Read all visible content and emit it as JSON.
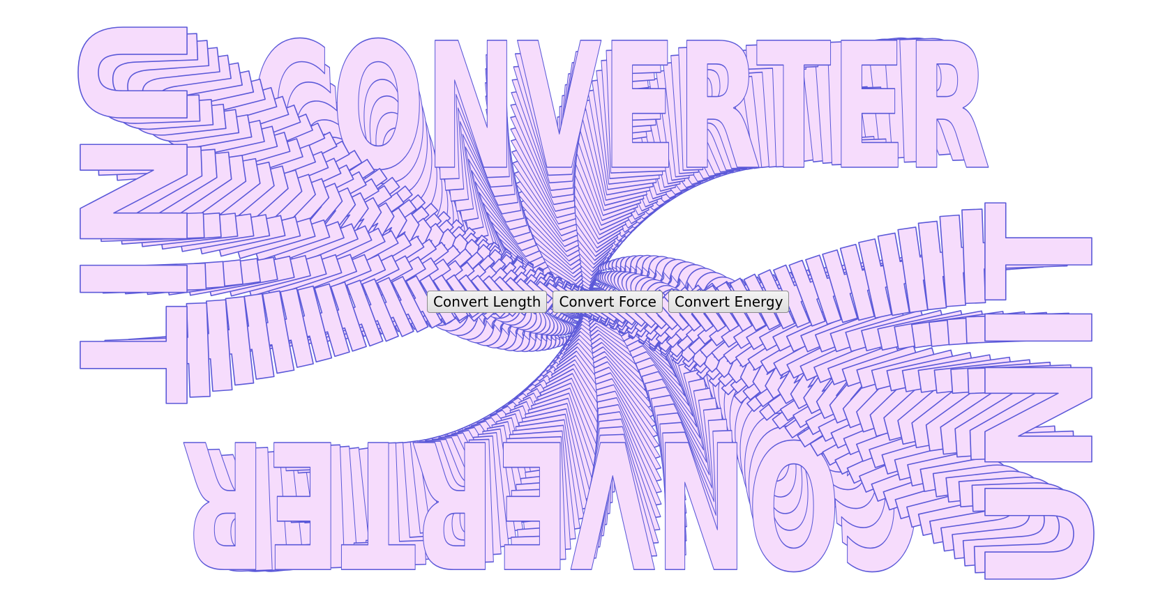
{
  "art": {
    "word_top": "CONVERTER",
    "word_bottom": "CONVERTER",
    "word_left": "UNIT",
    "word_right": "UNIT",
    "fill_color": "#f6dcfc",
    "stroke_color": "#5a58d8"
  },
  "buttons": {
    "length_label": "Convert Length",
    "force_label": "Convert Force",
    "energy_label": "Convert Energy"
  }
}
